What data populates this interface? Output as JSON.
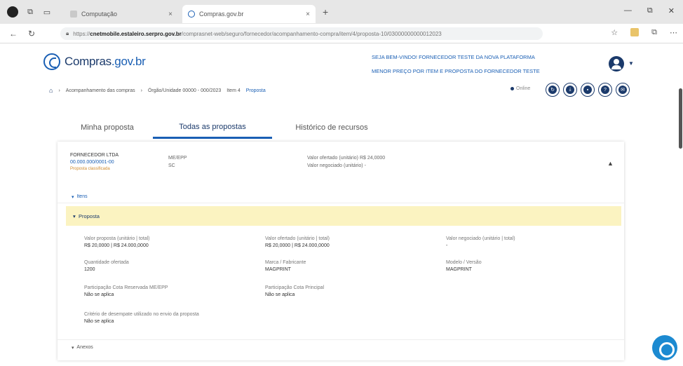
{
  "browser": {
    "tabs": [
      {
        "title": "Computação",
        "close": "×"
      },
      {
        "title": "Compras.gov.br",
        "close": "×"
      }
    ],
    "new_tab": "+",
    "url_prefix": "https://",
    "url_domain": "cnetmobile.estaleiro.serpro.gov.br",
    "url_path": "/comprasnet-web/seguro/fornecedor/acompanhamento-compra/item/4/proposta-10/03000000000012023",
    "window_controls": [
      "—",
      "⧉",
      "✕"
    ]
  },
  "header": {
    "logo_text": "Compras",
    "logo_gov": ".gov.br",
    "links": [
      "SEJA BEM-VINDO! FORNECEDOR TESTE DA NOVA PLATAFORMA",
      "MENOR PREÇO POR ITEM E PROPOSTA DO FORNECEDOR TESTE"
    ]
  },
  "breadcrumb": {
    "items": [
      "Acompanhamento das compras",
      "Órgão/Unidade 00000 - 000/2023",
      "Item 4"
    ],
    "current": "Proposta"
  },
  "toolbar": {
    "online_label": "Online"
  },
  "tabs": {
    "minha": "Minha proposta",
    "todas": "Todas as propostas",
    "historico": "Histórico de recursos"
  },
  "proposal": {
    "supplier_name": "FORNECEDOR LTDA",
    "supplier_cnpj": "00.000.000/0001-00",
    "supplier_tag": "Proposta classificada",
    "porte_label": "ME/EPP",
    "porte_value": "SC",
    "val_line1": "Valor ofertado (unitário)  R$ 24,0000",
    "val_line2": "Valor negociado (unitário)  -",
    "itens_label": "Itens",
    "proposta_label": "Proposta",
    "fields": {
      "valor_proposta_label": "Valor proposta (unitário | total)",
      "valor_proposta_value": "R$ 20,0000  |  R$ 24.000,0000",
      "valor_ofertado_label": "Valor ofertado (unitário | total)",
      "valor_ofertado_value": "R$ 20,0000  |  R$ 24.000,0000",
      "valor_negociado_label": "Valor negociado (unitário | total)",
      "valor_negociado_value": "-",
      "quantidade_label": "Quantidade ofertada",
      "quantidade_value": "1200",
      "marca_label": "Marca / Fabricante",
      "marca_value": "MAGPRINT",
      "modelo_label": "Modelo / Versão",
      "modelo_value": "MAGPRINT",
      "participacao_me_label": "Participação Cota Reservada ME/EPP",
      "participacao_me_value": "Não se aplica",
      "participacao_exp_label": "Participação Cota Principal",
      "participacao_exp_value": "Não se aplica",
      "criterio_label": "Critério de desempate utilizado no envio da proposta",
      "criterio_value": "Não se aplica"
    },
    "anexos_label": "Anexos"
  }
}
